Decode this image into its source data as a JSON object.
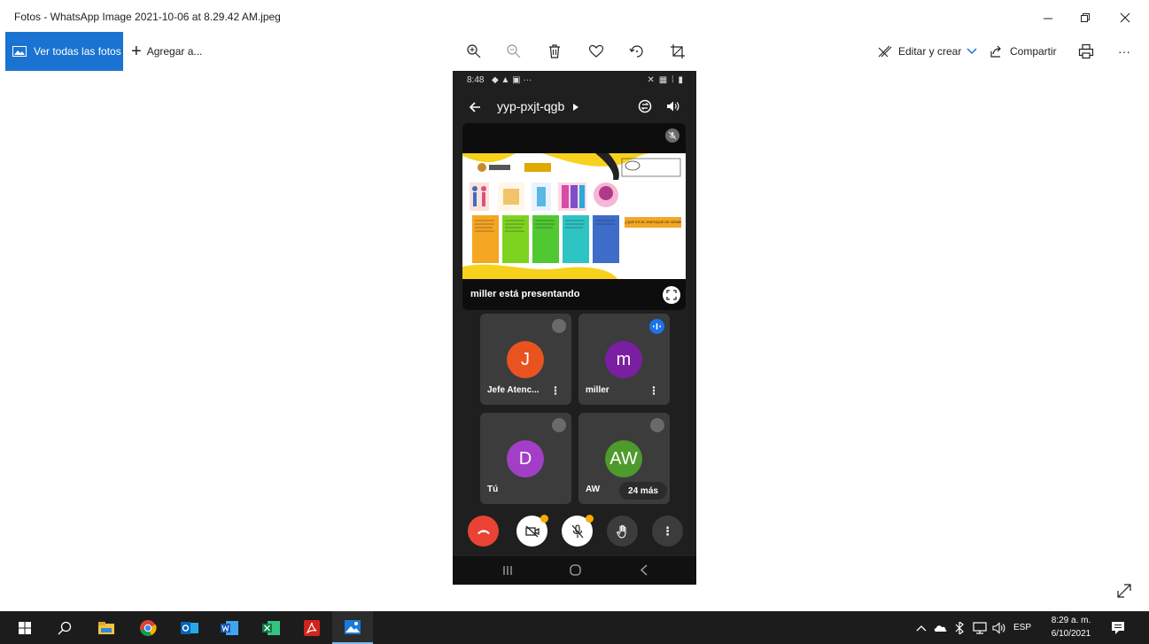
{
  "window": {
    "title": "Fotos - WhatsApp Image 2021-10-06 at 8.29.42 AM.jpeg",
    "minimize_icon": "minimize-icon",
    "maximize_icon": "restore-icon",
    "close_icon": "close-icon"
  },
  "toolbar": {
    "view_all_label": "Ver todas las fotos",
    "add_to_label": "Agregar a...",
    "edit_create_label": "Editar y crear",
    "share_label": "Compartir",
    "more_label": "···"
  },
  "phone": {
    "status_time": "8:48",
    "status_icons_left": "◆ ▲ ▣ ···",
    "status_icons_right": "✕ ▦ ⁞ ▮",
    "meeting_code": "yyp-pxjt-qgb",
    "presenter_label": "miller está presentando",
    "slide": {
      "question": "¿QUÉ ES EL ENFOQUE DE GÉNERO?",
      "card_colors": [
        "#f5a623",
        "#7ed321",
        "#50c832",
        "#2ec4c4",
        "#3d6cc9"
      ]
    },
    "participants": [
      {
        "initial": "J",
        "name": "Jefe Atenc...",
        "color": "#e8531f",
        "mic": "off"
      },
      {
        "initial": "m",
        "name": "miller",
        "color": "#7b1fa2",
        "mic": "active"
      },
      {
        "initial": "D",
        "name": "Tú",
        "color": "#a23fc6",
        "mic": "off"
      },
      {
        "initial": "AW",
        "name": "AW",
        "color": "#4e9a2c",
        "mic": "off"
      }
    ],
    "tile_menu": "⋮",
    "more_participants": "24 más",
    "controls_menu": "⋮"
  },
  "taskbar": {
    "language": "ESP",
    "time": "8:29 a. m.",
    "date": "6/10/2021"
  }
}
